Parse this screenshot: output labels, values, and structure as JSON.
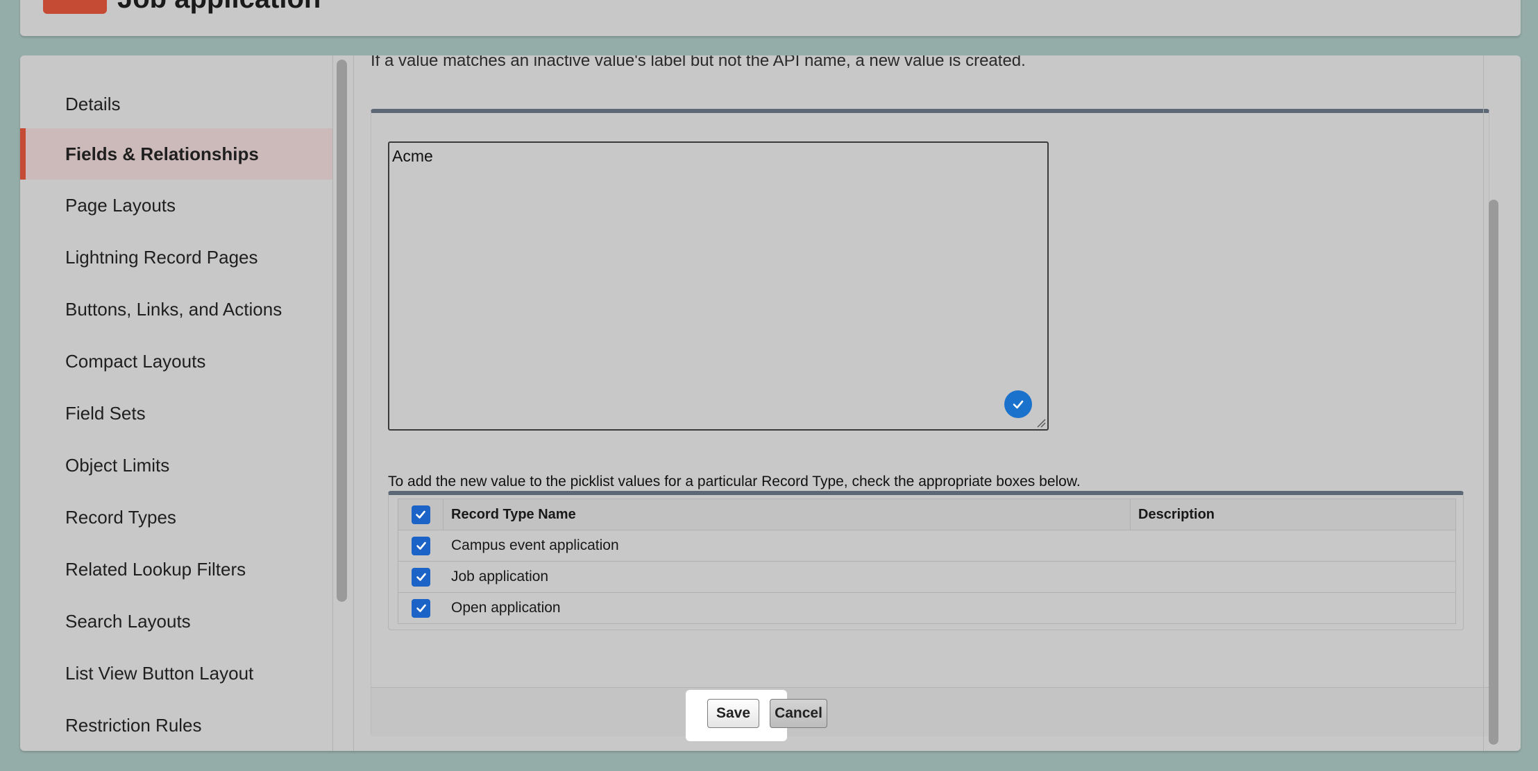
{
  "header": {
    "title": "Job application"
  },
  "sidebar": {
    "items": [
      {
        "label": "Details"
      },
      {
        "label": "Fields & Relationships"
      },
      {
        "label": "Page Layouts"
      },
      {
        "label": "Lightning Record Pages"
      },
      {
        "label": "Buttons, Links, and Actions"
      },
      {
        "label": "Compact Layouts"
      },
      {
        "label": "Field Sets"
      },
      {
        "label": "Object Limits"
      },
      {
        "label": "Record Types"
      },
      {
        "label": "Related Lookup Filters"
      },
      {
        "label": "Search Layouts"
      },
      {
        "label": "List View Button Layout"
      },
      {
        "label": "Restriction Rules"
      }
    ],
    "active_item": "Fields & Relationships"
  },
  "content": {
    "info_text": "If a value matches an inactive value's label but not the API name, a new value is created.",
    "values_textarea": {
      "value": "Acme"
    },
    "record_type_instruction": "To add the new value to the picklist values for a particular Record Type, check the appropriate boxes below.",
    "record_type_table": {
      "headers": {
        "name": "Record Type Name",
        "description": "Description"
      },
      "select_all_checked": true,
      "rows": [
        {
          "name": "Campus event application",
          "checked": true
        },
        {
          "name": "Job application",
          "checked": true
        },
        {
          "name": "Open application",
          "checked": true
        }
      ]
    },
    "buttons": {
      "save": "Save",
      "cancel": "Cancel"
    }
  },
  "colors": {
    "page_background": "#95ada9",
    "card_background": "#c8c8c8",
    "accent": "#c64b35",
    "active_nav_background": "#ccb9ba",
    "checkbox_blue": "#1b63c6",
    "panel_top_border": "#5d6877"
  }
}
